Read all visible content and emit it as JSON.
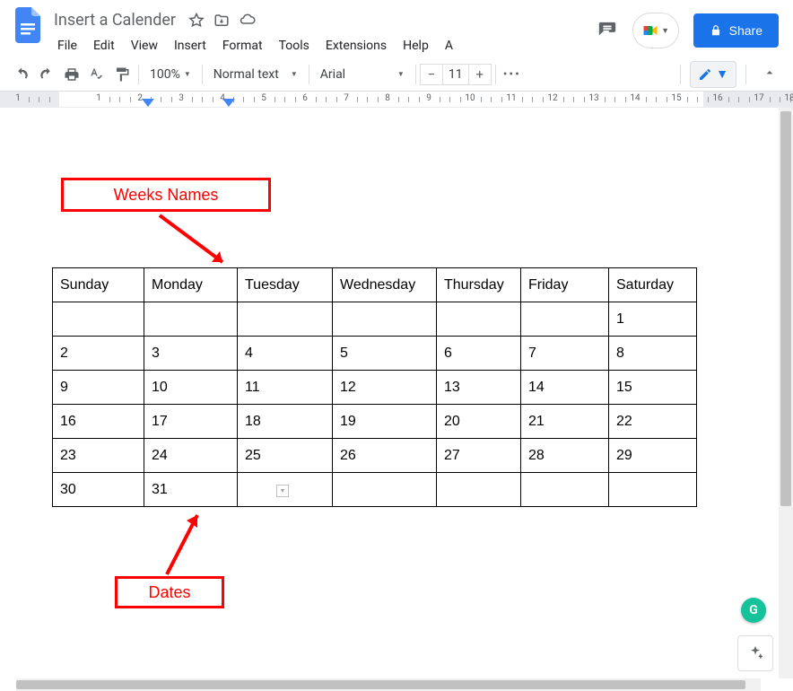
{
  "header": {
    "doc_title": "Insert a Calender",
    "share_label": "Share"
  },
  "menubar": [
    "File",
    "Edit",
    "View",
    "Insert",
    "Format",
    "Tools",
    "Extensions",
    "Help",
    "A"
  ],
  "toolbar": {
    "zoom": "100%",
    "style": "Normal text",
    "font": "Arial",
    "font_size": "11"
  },
  "ruler": {
    "numbers": [
      1,
      1,
      2,
      3,
      4,
      5,
      6,
      7,
      8,
      9,
      10,
      11,
      12,
      13,
      14,
      15,
      16,
      17,
      18
    ]
  },
  "annotations": {
    "weeks_label": "Weeks Names",
    "dates_label": "Dates"
  },
  "calendar": {
    "headers": [
      "Sunday",
      "Monday",
      "Tuesday",
      "Wednesday",
      "Thursday",
      "Friday",
      "Saturday"
    ],
    "rows": [
      [
        "",
        "",
        "",
        "",
        "",
        "",
        "1"
      ],
      [
        "2",
        "3",
        "4",
        "5",
        "6",
        "7",
        "8"
      ],
      [
        "9",
        "10",
        "11",
        "12",
        "13",
        "14",
        "15"
      ],
      [
        "16",
        "17",
        "18",
        "19",
        "20",
        "21",
        "22"
      ],
      [
        "23",
        "24",
        "25",
        "26",
        "27",
        "28",
        "29"
      ],
      [
        "30",
        "31",
        "",
        "",
        "",
        "",
        ""
      ]
    ]
  },
  "grammarly_glyph": "G"
}
